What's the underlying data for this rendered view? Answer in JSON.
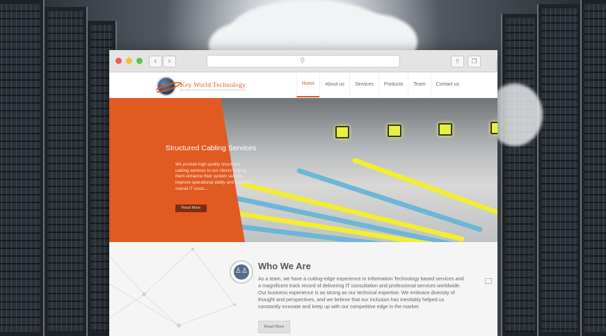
{
  "browser": {
    "back_symbol": "‹",
    "forward_symbol": "›",
    "share_icon": "share-icon",
    "tabs_icon": "tabs-icon",
    "new_tab_symbol": "+",
    "traffic_colors": [
      "#ee5a55",
      "#f3bd3a",
      "#59c747"
    ]
  },
  "header": {
    "logo_text": "Key World Technology",
    "nav": [
      {
        "label": "Home",
        "active": true
      },
      {
        "label": "About us"
      },
      {
        "label": "Services"
      },
      {
        "label": "Products"
      },
      {
        "label": "Team"
      },
      {
        "label": "Contact us"
      }
    ]
  },
  "hero": {
    "title": "Structured Cabling Services",
    "description": "We provide high quality structured cabling services to our clients helping them enhance their system security, improve operational ability and minimize overall IT costs...",
    "button": "Read More",
    "accent": "#e15a21"
  },
  "about": {
    "title": "Who We Are",
    "text": "As a team, we have a cutting-edge experience in Information Technology based services and a magnificent track record of delivering IT consultation and professional services worldwide. Our business experience is as strong as our technical expertise. We embrace diversity of thought and perspectives, and we believe that our inclusion has inevitably helped us constantly innovate and keep up with our competitive edge in the market.",
    "button": "Read More"
  }
}
